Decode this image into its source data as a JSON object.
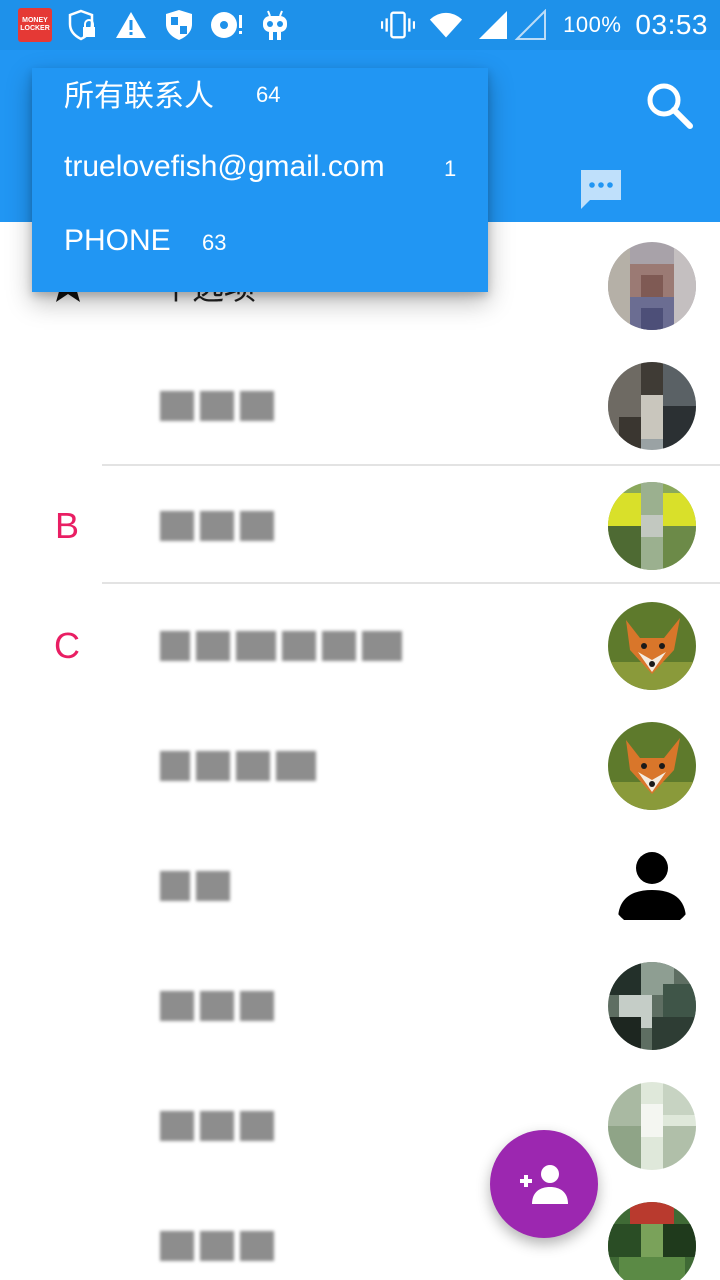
{
  "status_bar": {
    "app_badge_line1": "MONEY",
    "app_badge_line2": "LOCKER",
    "battery": "100%",
    "time": "03:53",
    "icons_left": [
      "money-locker-icon",
      "shield-lock-icon",
      "warning-icon",
      "security-shield-icon",
      "disc-alert-icon",
      "android-robot-icon"
    ],
    "icons_right": [
      "vibrate-icon",
      "wifi-icon",
      "signal-icon",
      "signal-empty-icon"
    ]
  },
  "toolbar": {
    "search_icon": "search-icon",
    "messages_icon": "chat-bubble-icon"
  },
  "account_dropdown": {
    "items": [
      {
        "label": "所有联系人",
        "count": "64"
      },
      {
        "label": "truelovefish@gmail.com",
        "count": "1"
      },
      {
        "label": "PHONE",
        "count": "63"
      }
    ]
  },
  "contacts": {
    "section_letters": {
      "b": "B",
      "c": "C"
    },
    "favorites_label": "个选项",
    "rows": [
      {
        "section": "star",
        "avatar": "photo-1"
      },
      {
        "section": "",
        "avatar": "photo-2"
      },
      {
        "section": "B",
        "avatar": "photo-3"
      },
      {
        "section": "C",
        "avatar": "fox-photo"
      },
      {
        "section": "",
        "avatar": "fox-photo"
      },
      {
        "section": "",
        "avatar": "default-person-icon"
      },
      {
        "section": "",
        "avatar": "photo-4"
      },
      {
        "section": "",
        "avatar": "photo-5"
      },
      {
        "section": "",
        "avatar": "photo-6"
      }
    ]
  },
  "fab": {
    "icon": "add-person-icon"
  },
  "colors": {
    "status_bar": "#1e91ea",
    "toolbar": "#2196f3",
    "section_letter": "#e91e63",
    "fab": "#9c27b0"
  }
}
